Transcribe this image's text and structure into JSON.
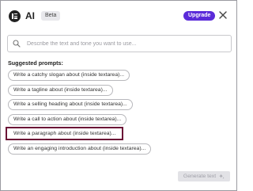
{
  "header": {
    "app_name": "AI",
    "beta_label": "Beta",
    "upgrade_label": "Upgrade",
    "icons": {
      "logo": "elementor-logo-icon",
      "close": "close-icon"
    }
  },
  "search": {
    "placeholder": "Describe the text and tone you want to use...",
    "value": "",
    "icon": "search-icon"
  },
  "suggestions": {
    "title": "Suggested prompts:",
    "items": [
      "Write a catchy slogan about (inside textarea)...",
      "Write a tagline about (inside textarea)...",
      "Write a selling heading about (inside textarea)...",
      "Write a call to action about (inside textarea)...",
      "Write a paragraph about (inside textarea)...",
      "Write an engaging introduction about (inside textarea)..."
    ],
    "highlighted_item": "Write a paragraph about (inside textarea)..."
  },
  "footer": {
    "generate_label": "Generate text",
    "generate_icon": "sparkle-icon",
    "generate_disabled": true
  },
  "colors": {
    "accent": "#5b2bd9",
    "highlight_border": "#6b1436",
    "disabled_bg": "#e2e2e6",
    "disabled_text": "#a0a0a8"
  }
}
